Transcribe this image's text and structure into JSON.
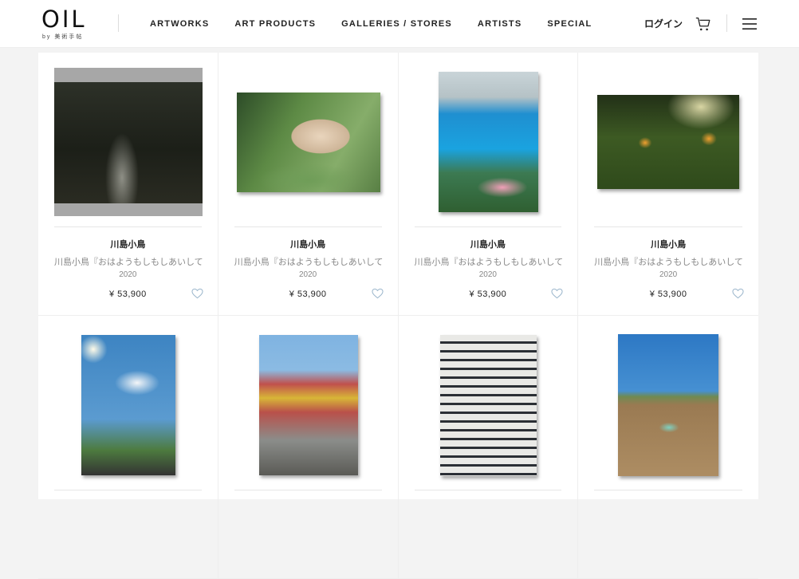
{
  "brand": {
    "name": "OIL",
    "sub": "by 美術手帖"
  },
  "nav": {
    "items": [
      "ARTWORKS",
      "ART PRODUCTS",
      "GALLERIES / STORES",
      "ARTISTS",
      "SPECIAL"
    ],
    "login": "ログイン"
  },
  "products": [
    {
      "artist": "川島小鳥",
      "title": "川島小鳥『おはようもしもしあいしてる』",
      "year": "2020",
      "price": "¥ 53,900",
      "image": "river-birds"
    },
    {
      "artist": "川島小鳥",
      "title": "川島小鳥『おはようもしもしあいしてる』",
      "year": "2020",
      "price": "¥ 53,900",
      "image": "cat"
    },
    {
      "artist": "川島小鳥",
      "title": "川島小鳥『おはようもしもしあいしてる』",
      "year": "2020",
      "price": "¥ 53,900",
      "image": "window-flowers"
    },
    {
      "artist": "川島小鳥",
      "title": "川島小鳥『おはようもしもしあいしてる』",
      "year": "2020",
      "price": "¥ 53,900",
      "image": "garden-flowers"
    },
    {
      "artist": "",
      "title": "",
      "year": "",
      "price": "",
      "image": "cloud-sky"
    },
    {
      "artist": "",
      "title": "",
      "year": "",
      "price": "",
      "image": "city-street"
    },
    {
      "artist": "",
      "title": "",
      "year": "",
      "price": "",
      "image": "parking-lot"
    },
    {
      "artist": "",
      "title": "",
      "year": "",
      "price": "",
      "image": "dry-field"
    }
  ],
  "colors": {
    "accent_heart": "#9bb6cc",
    "text": "#222222",
    "muted": "#888888"
  }
}
